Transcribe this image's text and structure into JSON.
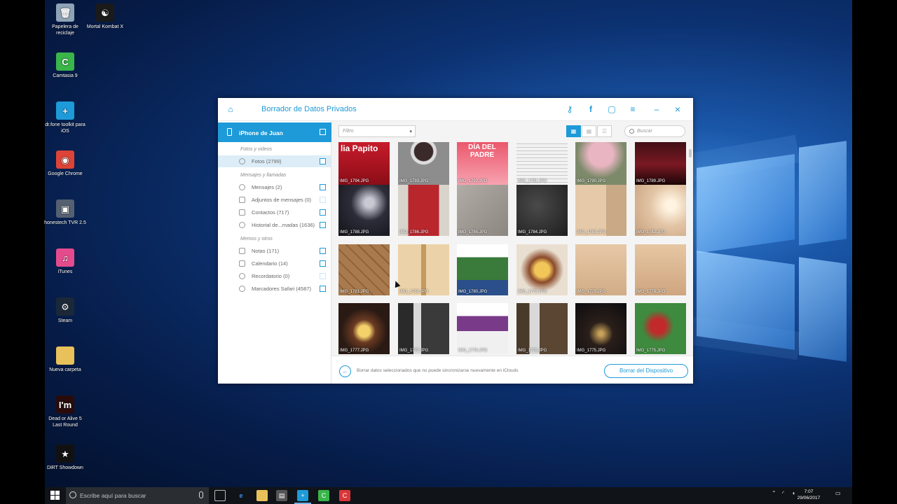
{
  "desktop": {
    "icons": [
      {
        "label": "Papelera de reciclaje",
        "icon": "recycle-bin-icon",
        "color": "#8fa3b6",
        "glyph": "🗑"
      },
      {
        "label": "Mortal Kombat X",
        "icon": "mortal-kombat-icon",
        "color": "#1a1a1a",
        "glyph": "☯"
      },
      {
        "label": "Camtasia 9",
        "icon": "camtasia-icon",
        "color": "#39b54a",
        "glyph": "C"
      },
      {
        "label": "dr.fone toolkit para iOS",
        "icon": "drfone-icon",
        "color": "#1e9ad8",
        "glyph": "+"
      },
      {
        "label": "Google Chrome",
        "icon": "chrome-icon",
        "color": "#db4437",
        "glyph": "◉"
      },
      {
        "label": "honestech TVR 2.5",
        "icon": "honestech-icon",
        "color": "#556070",
        "glyph": "▣"
      },
      {
        "label": "iTunes",
        "icon": "itunes-icon",
        "color": "#e44b8d",
        "glyph": "♫"
      },
      {
        "label": "Steam",
        "icon": "steam-icon",
        "color": "#1b2838",
        "glyph": "⚙"
      },
      {
        "label": "Nueva carpeta",
        "icon": "folder-icon",
        "color": "#e8c15a",
        "glyph": ""
      },
      {
        "label": "Dead or Alive 5 Last Round",
        "icon": "doa5-icon",
        "color": "#2a0b0b",
        "glyph": "I'm"
      },
      {
        "label": "DiRT Showdown",
        "icon": "dirt-icon",
        "color": "#111111",
        "glyph": "★"
      }
    ]
  },
  "window": {
    "title": "Borrador de Datos Privados",
    "accent": "#1e9ad8",
    "device_label": "iPhone de Juan",
    "sections": {
      "photos_header": "Fotos y videos",
      "messages_header": "Mensajes y llamadas",
      "memos_header": "Memos y otros"
    },
    "items": {
      "fotos": "Fotos (2799)",
      "mensajes": "Mensajes (2)",
      "adjuntos": "Adjuntos de mensajes (0)",
      "contactos": "Contactos (717)",
      "historial": "Historial de...madas (1636)",
      "notas": "Notas (171)",
      "calendario": "Calendario (14)",
      "recordatorio": "Recordatorio (0)",
      "marcadores": "Marcadores Safari (4587)"
    },
    "filter_placeholder": "Filtro",
    "search_placeholder": "Buscar",
    "footer_note": "Borrar datos seleccionados que no puede sincronizarse nuevamente en iClouds",
    "erase_button": "Borrar del Dispositivo"
  },
  "photos": [
    {
      "name": "IMG_1794.JPG",
      "bg": "linear-gradient(180deg,#d41e2e,#8a0d17)",
      "overlay": "lia Papito"
    },
    {
      "name": "IMG_1793.JPG",
      "bg": "radial-gradient(circle at 50% 35%,#3a2a2a 0 22%,#ddd 24% 30%,#8d8d8d 32%)",
      "overlay": ""
    },
    {
      "name": "IMG_1792.JPG",
      "bg": "linear-gradient(180deg,#e8495f,#f7a3b0)",
      "overlay": "DÍA DEL PADRE"
    },
    {
      "name": "IMG_1791.JPG",
      "bg": "repeating-linear-gradient(180deg,#f2f2f2 0 4px,#c9c9c9 4px 5px)",
      "overlay": ""
    },
    {
      "name": "IMG_1790.JPG",
      "bg": "radial-gradient(circle at 50% 40%,#e9b5c2 0 30%,#7d8a6a 60%)",
      "overlay": ""
    },
    {
      "name": "IMG_1789.JPG",
      "bg": "linear-gradient(180deg,#2b0d10,#7a1822 60%,#1a0507)",
      "overlay": ""
    },
    {
      "name": "IMG_1788.JPG",
      "bg": "radial-gradient(circle at 60% 35%,#c9c9d4 0 10%,#2d2d3a 40%,#121218)",
      "overlay": ""
    },
    {
      "name": "IMG_1786.JPG",
      "bg": "linear-gradient(90deg,#d8d4cc 0 20%,#b9262c 20% 80%,#d8d4cc 80%)",
      "overlay": ""
    },
    {
      "name": "IMG_1785.JPG",
      "bg": "linear-gradient(135deg,#b2aca6,#8c8680)",
      "overlay": ""
    },
    {
      "name": "IMG_1784.JPG",
      "bg": "radial-gradient(circle at 40% 40%,#4a4a4a,#1e1e1e)",
      "overlay": ""
    },
    {
      "name": "IMG_1783.JPG",
      "bg": "linear-gradient(90deg,#e6c9a8 0 60%,#c9a986 60%)",
      "overlay": ""
    },
    {
      "name": "IMG_1782.JPG",
      "bg": "radial-gradient(circle at 70% 40%,#fff4e2 0 10%,#e2c4a4 45%,#c69f7d)",
      "overlay": ""
    },
    {
      "name": "IMG_1781.JPG",
      "bg": "repeating-linear-gradient(45deg,#a87a4d 0 10px,#8e6037 10px 12px)",
      "overlay": ""
    },
    {
      "name": "IMG_1780.JPG",
      "bg": "linear-gradient(90deg,#ecd2a8 0 45%,#c49a60 45% 55%,#ecd2a8 55%)",
      "overlay": ""
    },
    {
      "name": "IMG_1780.JPG",
      "bg": "linear-gradient(180deg,#ffffff 0 25%,#3a7a3a 25% 70%,#2a4f8a 70%)",
      "overlay": ""
    },
    {
      "name": "IMG_1779.JPG",
      "bg": "radial-gradient(circle at 50% 50%,#f3c65a 0 20%,#8a4a2a 35%,#e9dfd0 60%)",
      "overlay": ""
    },
    {
      "name": "IMG_1779.JPG",
      "bg": "linear-gradient(180deg,#e7c8a6,#d1ad87)",
      "overlay": ""
    },
    {
      "name": "IMG_1778.JPG",
      "bg": "linear-gradient(180deg,#e6c7a3,#cfa57f)",
      "overlay": ""
    },
    {
      "name": "IMG_1777.JPG",
      "bg": "radial-gradient(circle at 50% 55%,#f5d16b 0 15%,#6a3a22 30%,#2a1a14 60%)",
      "overlay": ""
    },
    {
      "name": "IMG_1777.JPG",
      "bg": "linear-gradient(90deg,#2a2a2a 0 30%,#d8d8d8 30% 45%,#3a3a3a 45%)",
      "overlay": ""
    },
    {
      "name": "IMG_1776.JPG",
      "bg": "linear-gradient(180deg,#ffffff 0 25%,#7a3a8a 25% 55%,#f0f0f0 55%)",
      "overlay": ""
    },
    {
      "name": "IMG_1776.JPG",
      "bg": "linear-gradient(90deg,#4a3a2a 0 25%,#d9d9d9 25% 45%,#5a4632 45%)",
      "overlay": ""
    },
    {
      "name": "IMG_1775.JPG",
      "bg": "radial-gradient(circle at 50% 60%,#c9a25a 0 5%,#2a1f1a 30%,#0c0b0f)",
      "overlay": ""
    },
    {
      "name": "IMG_1775.JPG",
      "bg": "radial-gradient(circle at 45% 45%,#c22a2a 0 18%,#3e8a3e 40%)",
      "overlay": ""
    }
  ],
  "taskbar": {
    "search_placeholder": "Escribe aquí para buscar",
    "time": "7:07",
    "date": "29/06/2017"
  }
}
